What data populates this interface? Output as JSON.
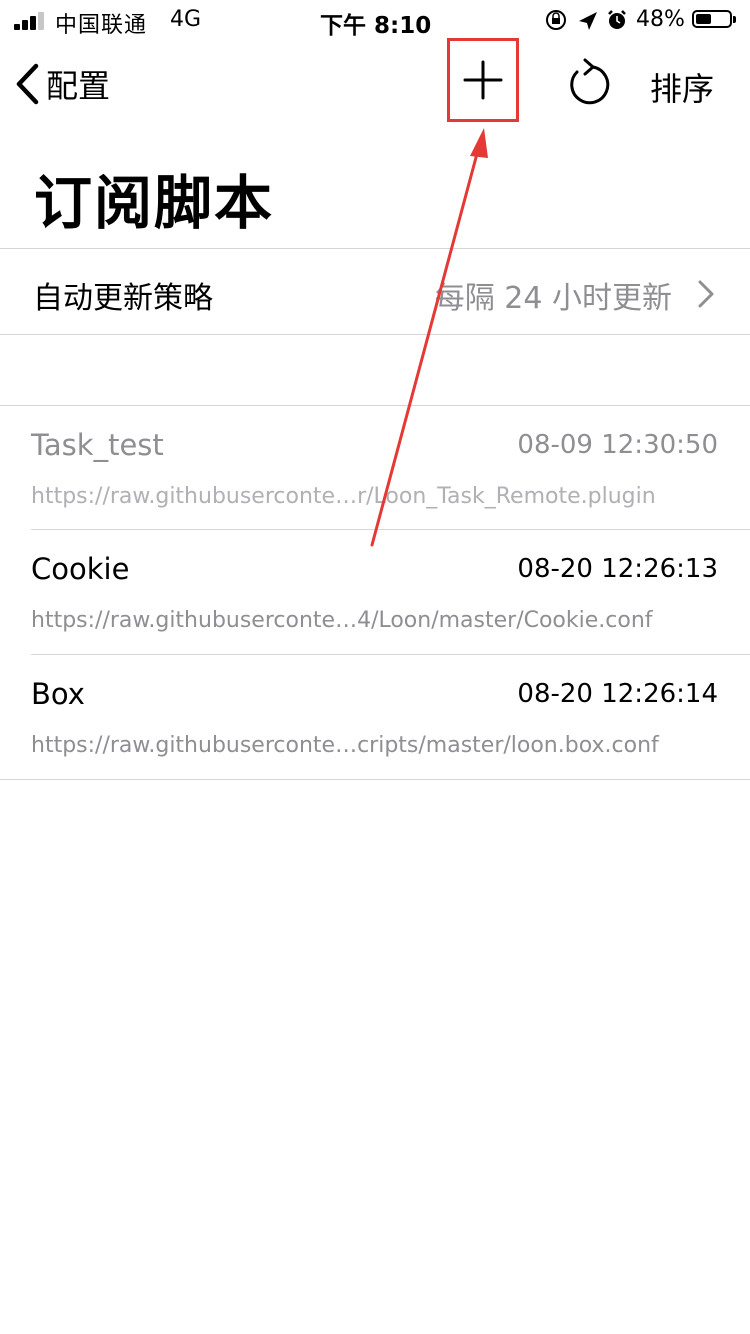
{
  "status_bar": {
    "carrier": "中国联通",
    "network": "4G",
    "time": "下午 8:10",
    "battery": "48%",
    "battery_level": 0.48,
    "icons": [
      "orientation-lock-icon",
      "location-arrow-icon",
      "alarm-icon"
    ]
  },
  "nav": {
    "back_label": "配置",
    "sort_label": "排序",
    "add_icon": "plus-icon",
    "refresh_icon": "refresh-icon"
  },
  "page": {
    "title": "订阅脚本"
  },
  "auto_update": {
    "label": "自动更新策略",
    "value": "每隔 24 小时更新"
  },
  "subscriptions": [
    {
      "name": "Task_test",
      "time": "08-09 12:30:50",
      "url": "https://raw.githubuserconte…r/Loon_Task_Remote.plugin",
      "enabled": false
    },
    {
      "name": "Cookie",
      "time": "08-20 12:26:13",
      "url": "https://raw.githubuserconte…4/Loon/master/Cookie.conf",
      "enabled": true
    },
    {
      "name": "Box",
      "time": "08-20 12:26:14",
      "url": "https://raw.githubuserconte…cripts/master/loon.box.conf",
      "enabled": true
    }
  ],
  "colors": {
    "annotation": "#e53935",
    "secondary_text": "#8e8e93",
    "separator": "#d6d6d8"
  }
}
